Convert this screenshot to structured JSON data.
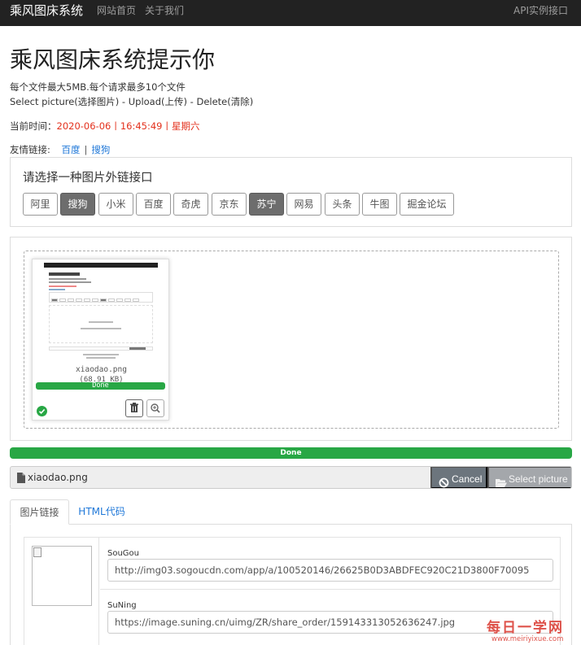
{
  "navbar": {
    "brand": "乘风图床系统",
    "home": "网站首页",
    "about": "关于我们",
    "api": "API实例接口"
  },
  "main": {
    "title": "乘风图床系统提示你",
    "limit": "每个文件最大5MB.每个请求最多10个文件",
    "steps": "Select picture(选择图片) - Upload(上传) - Delete(清除)",
    "time_label": "当前时间：",
    "time_value": "2020-06-06丨16:45:49丨星期六",
    "links_label": "友情链接:",
    "links": [
      "百度",
      "搜狗"
    ]
  },
  "api_panel": {
    "title": "请选择一种图片外链接口",
    "options": [
      "阿里",
      "搜狗",
      "小米",
      "百度",
      "奇虎",
      "京东",
      "苏宁",
      "网易",
      "头条",
      "牛图",
      "掘金论坛"
    ],
    "selected": [
      "搜狗",
      "苏宁"
    ]
  },
  "preview": {
    "file_name": "xiaodao.png",
    "file_size": "(68.91 KB)",
    "status": "Done"
  },
  "progress": {
    "label": "Done",
    "percent": 100
  },
  "file_bar": {
    "file_name": "xiaodao.png",
    "cancel": "Cancel",
    "select": "Select picture"
  },
  "tabs": [
    "图片链接",
    "HTML代码"
  ],
  "results": [
    {
      "label": "SouGou",
      "url": "http://img03.sogoucdn.com/app/a/100520146/26625B0D3ABDFEC920C21D3800F70095"
    },
    {
      "label": "SuNing",
      "url": "https://image.suning.cn/uimg/ZR/share_order/159143313052636247.jpg"
    }
  ],
  "watermark": {
    "text": "每日一学网",
    "url": "www.meiriyixue.com"
  },
  "colors": {
    "navbar": "#222222",
    "success": "#28a745",
    "time_red": "#e3311d",
    "link_blue": "#1e77d8",
    "selected_button": "#6d6d6d",
    "cancel_button": "#6c757d",
    "select_button": "#a4a7ab"
  }
}
